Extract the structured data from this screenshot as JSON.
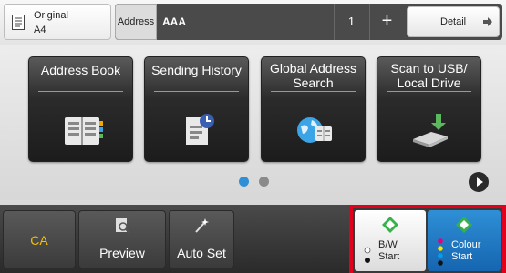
{
  "original": {
    "label": "Original",
    "value": "A4",
    "icon": "original-doc-icon"
  },
  "address": {
    "label": "Address",
    "value": "AAA",
    "count": "1",
    "add_symbol": "+"
  },
  "detail": {
    "label": "Detail",
    "icon": "arrow-right-icon"
  },
  "tiles": [
    {
      "title": "Address Book",
      "icon": "address-book-icon"
    },
    {
      "title": "Sending History",
      "icon": "sending-history-icon"
    },
    {
      "title": "Global Address Search",
      "icon": "global-address-search-icon"
    },
    {
      "title": "Scan to USB/ Local Drive",
      "icon": "usb-drive-icon"
    }
  ],
  "pager": {
    "pages": 2,
    "current": 1
  },
  "bottom": {
    "ca": "CA",
    "preview": "Preview",
    "auto_set": "Auto Set",
    "bw_start": "B/W\nStart",
    "colour_start": "Colour\nStart"
  },
  "colors": {
    "ca_text": "#f4c000",
    "active_dot": "#2f8fd6",
    "inactive_dot": "#8a8a8a",
    "start_border": "#e2001a",
    "start_diamond": "#36b24a",
    "colour_button": "#1f7bc4"
  }
}
